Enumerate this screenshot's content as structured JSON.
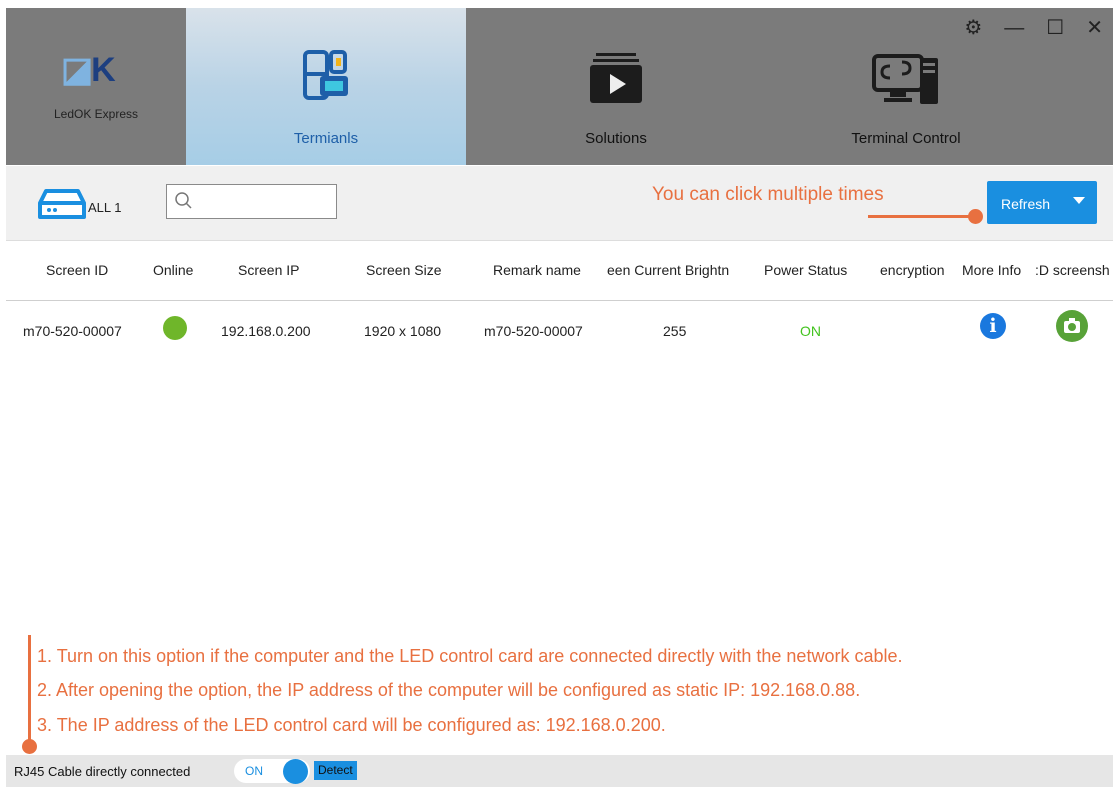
{
  "app": {
    "logo": "LedOK Express"
  },
  "nav": {
    "tabs": [
      {
        "label": "Termianls",
        "icon": "terminals-icon"
      },
      {
        "label": "Solutions",
        "icon": "solutions-icon"
      },
      {
        "label": "Terminal Control",
        "icon": "terminal-control-icon"
      }
    ],
    "window_controls": [
      "settings-icon",
      "minimize-icon",
      "maximize-icon",
      "close-icon"
    ]
  },
  "toolbar": {
    "all_label": "ALL 1",
    "search_placeholder": "",
    "refresh_label": "Refresh",
    "annotation": "You can click multiple times"
  },
  "table": {
    "headers": [
      "Screen ID",
      "Online",
      "Screen IP",
      "Screen Size",
      "Remark name",
      "een Current Brightn",
      "Power Status",
      "encryption",
      "More Info",
      ":D screensh"
    ],
    "rows": [
      {
        "screen_id": "m70-520-00007",
        "online": "green",
        "ip": "192.168.0.200",
        "size": "1920 x 1080",
        "remark": "m70-520-00007",
        "brightness": "255",
        "power": "ON",
        "encryption": ""
      }
    ]
  },
  "notes": [
    "1. Turn on this option if the computer and the LED control card are connected directly with the network cable.",
    "2. After opening the option, the IP address of the computer will be configured as static IP: 192.168.0.88.",
    "3. The IP address of the LED control card will be configured as: 192.168.0.200."
  ],
  "status_bar": {
    "label": "RJ45 Cable directly connected",
    "toggle": "ON",
    "detect": "Detect"
  },
  "colors": {
    "accent": "#1a8fe0",
    "annotation": "#e87040",
    "online": "#6fb62a",
    "nav_bg": "#7b7b7b"
  }
}
